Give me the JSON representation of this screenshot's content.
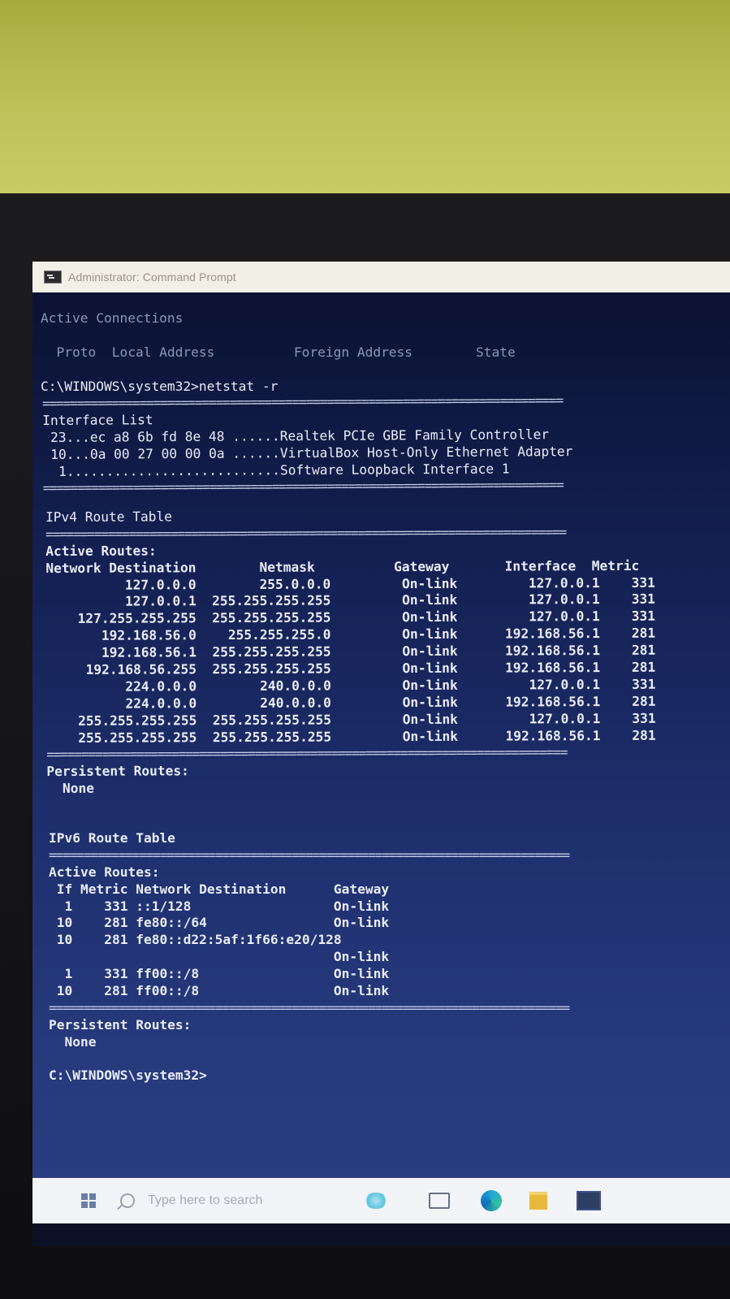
{
  "window": {
    "title": "Administrator: Command Prompt"
  },
  "console": {
    "header": {
      "active_connections": "Active Connections",
      "columns": "  Proto  Local Address          Foreign Address        State"
    },
    "command": "C:\\WINDOWS\\system32>netstat -r",
    "separator": "===========================================================================",
    "interface_list": {
      "title": "Interface List",
      "lines": [
        " 23...ec a8 6b fd 8e 48 ......Realtek PCIe GBE Family Controller",
        " 10...0a 00 27 00 00 0a ......VirtualBox Host-Only Ethernet Adapter",
        "  1...........................Software Loopback Interface 1"
      ]
    },
    "ipv4": {
      "title": "IPv4 Route Table",
      "active_routes_label": "Active Routes:",
      "header": "Network Destination        Netmask          Gateway       Interface  Metric",
      "rows": [
        "          127.0.0.0        255.0.0.0         On-link         127.0.0.1    331",
        "          127.0.0.1  255.255.255.255         On-link         127.0.0.1    331",
        "    127.255.255.255  255.255.255.255         On-link         127.0.0.1    331",
        "       192.168.56.0    255.255.255.0         On-link      192.168.56.1    281",
        "       192.168.56.1  255.255.255.255         On-link      192.168.56.1    281",
        "     192.168.56.255  255.255.255.255         On-link      192.168.56.1    281",
        "          224.0.0.0        240.0.0.0         On-link         127.0.0.1    331",
        "          224.0.0.0        240.0.0.0         On-link      192.168.56.1    281",
        "    255.255.255.255  255.255.255.255         On-link         127.0.0.1    331",
        "    255.255.255.255  255.255.255.255         On-link      192.168.56.1    281"
      ],
      "persistent_label": "Persistent Routes:",
      "persistent_value": "  None"
    },
    "ipv6": {
      "title": "IPv6 Route Table",
      "active_routes_label": "Active Routes:",
      "header": " If Metric Network Destination      Gateway",
      "rows": [
        "  1    331 ::1/128                  On-link",
        " 10    281 fe80::/64                On-link",
        " 10    281 fe80::d22:5af:1f66:e20/128",
        "                                    On-link",
        "  1    331 ff00::/8                 On-link",
        " 10    281 ff00::/8                 On-link"
      ],
      "persistent_label": "Persistent Routes:",
      "persistent_value": "  None"
    },
    "prompt": "C:\\WINDOWS\\system32>"
  },
  "taskbar": {
    "search_placeholder": "Type here to search",
    "icons": [
      "windows-start-icon",
      "search-icon",
      "cortana-icon",
      "task-view-icon",
      "edge-icon",
      "file-explorer-icon",
      "photos-icon"
    ]
  },
  "colors": {
    "console_text": "#e8ecf6",
    "console_bg_top": "#0b1233",
    "console_bg_bottom": "#2a3d80",
    "titlebar_bg": "#f1efe6"
  }
}
